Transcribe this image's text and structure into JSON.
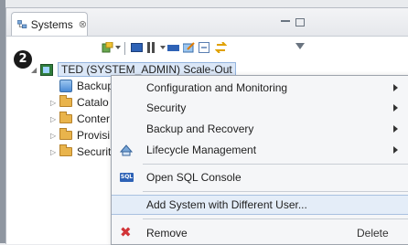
{
  "view": {
    "tab_title": "Systems",
    "tab_close": "⊗"
  },
  "callout_number": "2",
  "tree": {
    "system_label": "TED (SYSTEM_ADMIN) Scale-Out",
    "children": [
      "Backup",
      "Catalo",
      "Conter",
      "Provisi",
      "Securit"
    ]
  },
  "context_menu": {
    "items": [
      {
        "label": "Configuration and Monitoring",
        "submenu": true
      },
      {
        "label": "Security",
        "submenu": true
      },
      {
        "label": "Backup and Recovery",
        "submenu": true
      },
      {
        "label": "Lifecycle Management",
        "submenu": true,
        "icon": "lifecycle-icon"
      },
      {
        "label": "Open SQL Console",
        "icon": "sql-icon",
        "icon_text": "SQL"
      },
      {
        "label": "Add System with Different User...",
        "highlighted": true
      },
      {
        "label": "Remove",
        "shortcut": "Delete",
        "icon": "remove-icon",
        "icon_text": "✖"
      }
    ]
  },
  "colors": {
    "accent": "#2e62b6",
    "remove": "#d13438",
    "highlight": "#e4edf8"
  }
}
